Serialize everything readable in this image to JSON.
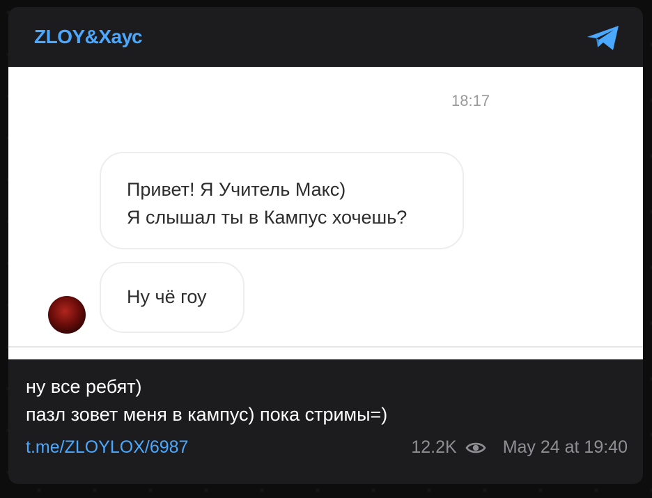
{
  "header": {
    "channel_name": "ZLOY&Хаус",
    "telegram_icon": "telegram-plane-icon"
  },
  "embedded_chat": {
    "time": "18:17",
    "messages": [
      {
        "lines": [
          "Привет! Я Учитель Макс)",
          "Я слышал ты в Кампус хочешь?"
        ]
      },
      {
        "lines": [
          "Ну чё гоу"
        ]
      }
    ],
    "avatar_icon": "avatar"
  },
  "post": {
    "lines": [
      "ну все ребят)",
      "пазл зовет меня в кампус) пока стримы=)"
    ],
    "link": "t.me/ZLOYLOX/6987",
    "views": "12.2K",
    "views_icon": "eye-icon",
    "date": "May 24 at 19:40"
  },
  "colors": {
    "accent": "#4aa8ff",
    "card_bg": "#1c1c1e",
    "meta_text": "#8e8e93"
  }
}
